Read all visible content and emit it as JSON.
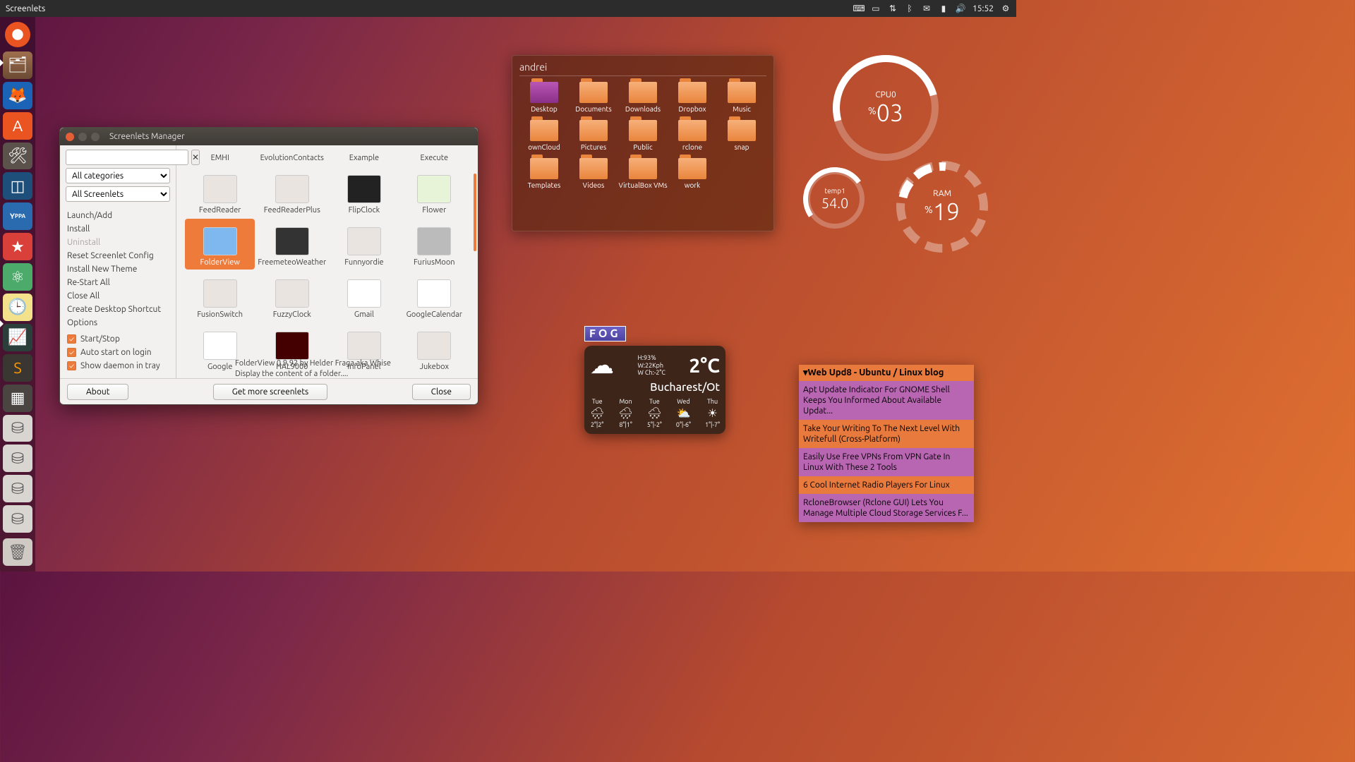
{
  "top_panel": {
    "app": "Screenlets",
    "time": "15:52"
  },
  "launcher": {
    "items": [
      "ubuntu",
      "files",
      "firefox",
      "software",
      "settings",
      "virtualbox",
      "yppa",
      "wunderlist",
      "atom",
      "screenlets",
      "terminal",
      "sublime",
      "workspace",
      "drive1",
      "drive2",
      "drive3",
      "drive4"
    ]
  },
  "manager": {
    "title": "Screenlets Manager",
    "category_sel": "All categories",
    "screenlet_sel": "All Screenlets",
    "menu": [
      {
        "label": "Launch/Add",
        "disabled": false
      },
      {
        "label": "Install",
        "disabled": false
      },
      {
        "label": "Uninstall",
        "disabled": true
      },
      {
        "label": "Reset Screenlet Config",
        "disabled": false
      },
      {
        "label": "Install New Theme",
        "disabled": false
      },
      {
        "label": "Re-Start All",
        "disabled": false
      },
      {
        "label": "Close All",
        "disabled": false
      },
      {
        "label": "Create Desktop Shortcut",
        "disabled": false
      },
      {
        "label": "Options",
        "disabled": false
      }
    ],
    "checks": [
      {
        "label": "Start/Stop"
      },
      {
        "label": "Auto start on login"
      },
      {
        "label": "Show daemon in tray"
      }
    ],
    "items_row0": [
      "EMHI",
      "EvolutionContacts",
      "Example",
      "Execute"
    ],
    "items": [
      "FeedReader",
      "FeedReaderPlus",
      "FlipClock",
      "Flower",
      "FolderView",
      "FreemeteoWeather",
      "Funnyordie",
      "FuriusMoon",
      "FusionSwitch",
      "FuzzyClock",
      "Gmail",
      "GoogleCalendar",
      "Google",
      "HAL9000",
      "InfoPanel",
      "Jukebox"
    ],
    "selected": "FolderView",
    "desc1": "FolderView 0.9.92 by Helder Fraga aka Whise",
    "desc2": "Display the content of a folder....",
    "btn_about": "About",
    "btn_more": "Get more screenlets",
    "btn_close": "Close"
  },
  "folder_view": {
    "title": "andrei",
    "items": [
      "Desktop",
      "Documents",
      "Downloads",
      "Dropbox",
      "Music",
      "ownCloud",
      "Pictures",
      "Public",
      "rclone",
      "snap",
      "Templates",
      "Videos",
      "VirtualBox VMs",
      "work"
    ]
  },
  "gauges": {
    "cpu": {
      "label": "CPU0",
      "value": "03"
    },
    "ram": {
      "label": "RAM",
      "value": "19"
    },
    "temp": {
      "label": "temp1",
      "value": "54.0"
    }
  },
  "weather": {
    "banner": "FOG",
    "humidity": "H:93%",
    "wind": "W:22Kph",
    "chill": "W Ch:-2°C",
    "temp": "2°C",
    "city": "Bucharest/Ot",
    "days": [
      {
        "d": "Tue",
        "r": "2°|2°"
      },
      {
        "d": "Mon",
        "r": "8°|1°"
      },
      {
        "d": "Tue",
        "r": "5°|-2°"
      },
      {
        "d": "Wed",
        "r": "0°|-6°"
      },
      {
        "d": "Thu",
        "r": "1°|-7°"
      }
    ]
  },
  "feed": {
    "title": "▾Web Upd8 - Ubuntu / Linux blog",
    "items": [
      "Apt Update Indicator For GNOME Shell Keeps You Informed About Available Updat...",
      "Take Your Writing To The Next Level With Writefull (Cross-Platform)",
      "Easily Use Free VPNs From VPN Gate In Linux With These 2 Tools",
      "6 Cool Internet Radio Players For Linux",
      "RcloneBrowser (Rclone GUI) Lets You Manage Multiple Cloud Storage Services F..."
    ]
  }
}
